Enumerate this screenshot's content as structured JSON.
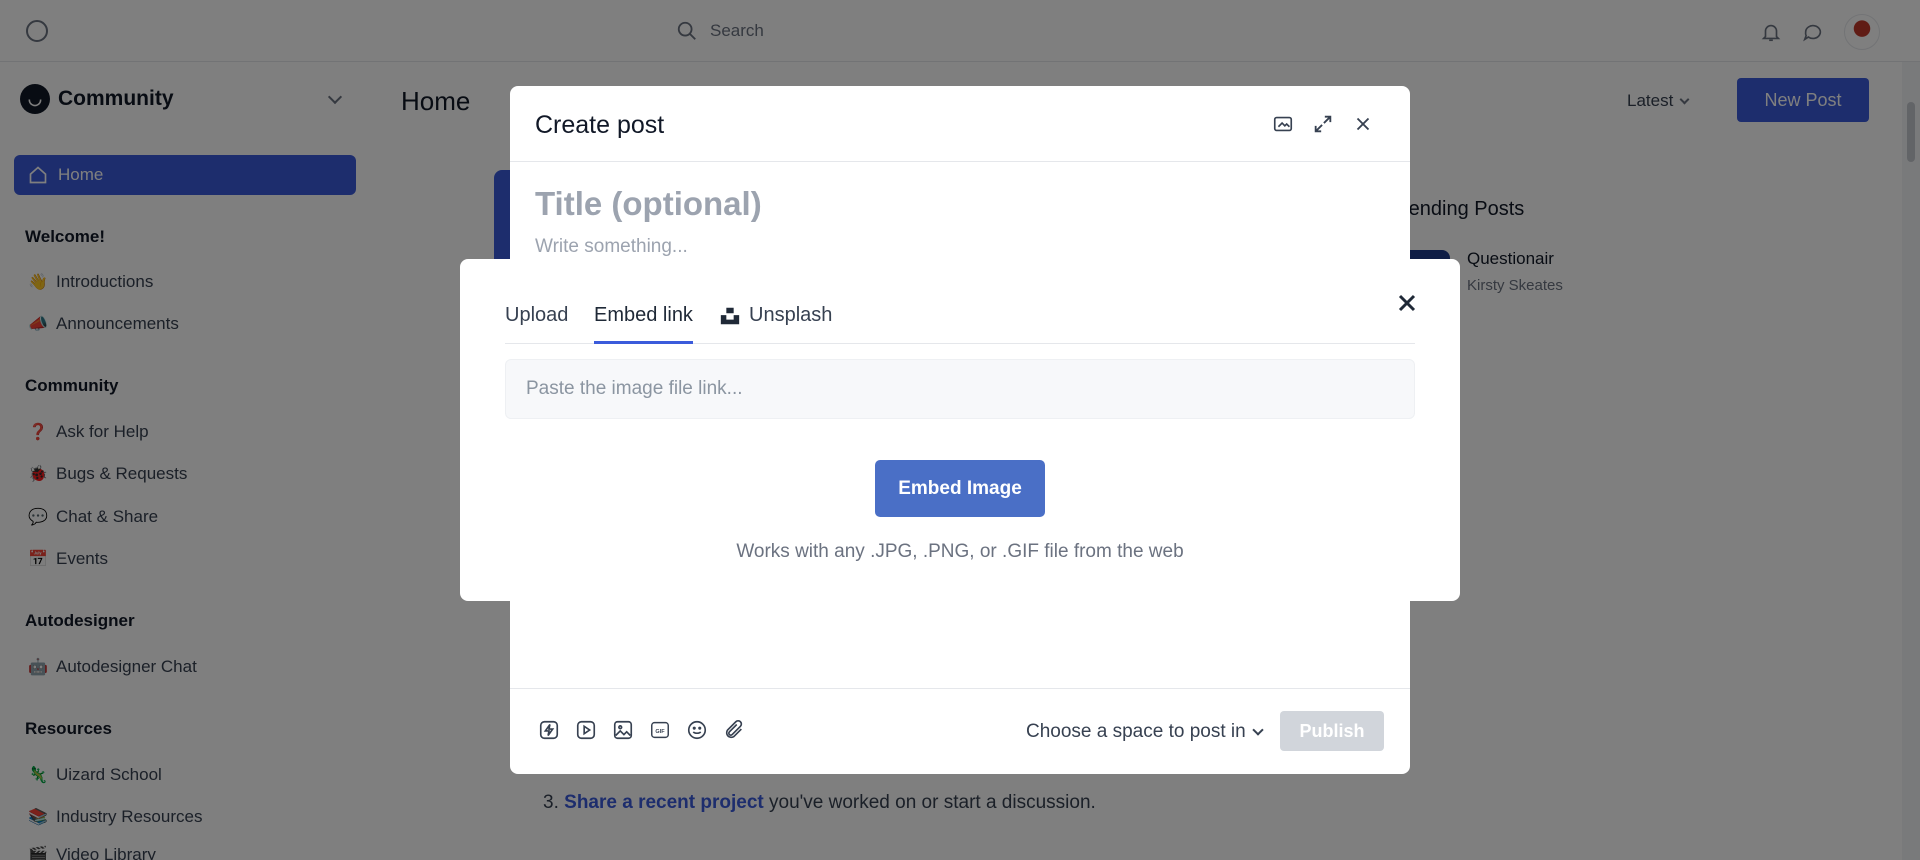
{
  "topbar": {
    "search_placeholder": "Search",
    "icons": [
      "logo-circle-icon",
      "search-icon",
      "bell-icon",
      "chat-icon",
      "avatar"
    ]
  },
  "sidebar": {
    "brand": "Community",
    "home": "Home",
    "sections": [
      {
        "title": "Welcome!",
        "items": [
          {
            "emoji": "👋",
            "label": "Introductions"
          },
          {
            "emoji": "📣",
            "label": "Announcements"
          }
        ]
      },
      {
        "title": "Community",
        "items": [
          {
            "emoji": "❓",
            "label": "Ask for Help"
          },
          {
            "emoji": "🐞",
            "label": "Bugs & Requests"
          },
          {
            "emoji": "💬",
            "label": "Chat & Share"
          },
          {
            "emoji": "📅",
            "label": "Events"
          }
        ]
      },
      {
        "title": "Autodesigner",
        "items": [
          {
            "emoji": "🤖",
            "label": "Autodesigner Chat"
          }
        ]
      },
      {
        "title": "Resources",
        "items": [
          {
            "emoji": "🦎",
            "label": "Uizard School"
          },
          {
            "emoji": "📚",
            "label": "Industry Resources"
          },
          {
            "emoji": "🎬",
            "label": "Video Library"
          }
        ]
      }
    ]
  },
  "main": {
    "title": "Home",
    "sort_label": "Latest",
    "new_post_label": "New Post",
    "trending_title": "rending Posts",
    "trending_post_title": "Questionair",
    "trending_post_author": "Kirsty Skeates",
    "step_number": "3.",
    "step_link": "Share a recent project",
    "step_rest": " you've worked on or start a discussion."
  },
  "create_post": {
    "title": "Create post",
    "title_placeholder": "Title (optional)",
    "body_placeholder": "Write something...",
    "space_label": "Choose a space to post in",
    "publish_label": "Publish",
    "tool_icons": [
      "lightning-icon",
      "video-icon",
      "image-icon",
      "gif-icon",
      "emoji-icon",
      "attachment-icon"
    ]
  },
  "embed_dialog": {
    "tabs": [
      "Upload",
      "Embed link",
      "Unsplash"
    ],
    "active_tab": "Embed link",
    "input_placeholder": "Paste the image file link...",
    "input_value": "",
    "button_label": "Embed Image",
    "hint": "Works with any .JPG, .PNG, or .GIF file from the web"
  },
  "colors": {
    "accent": "#3b5bdb",
    "embed_button": "#4a6fc6",
    "overlay": "rgba(0,0,0,0.5)"
  }
}
